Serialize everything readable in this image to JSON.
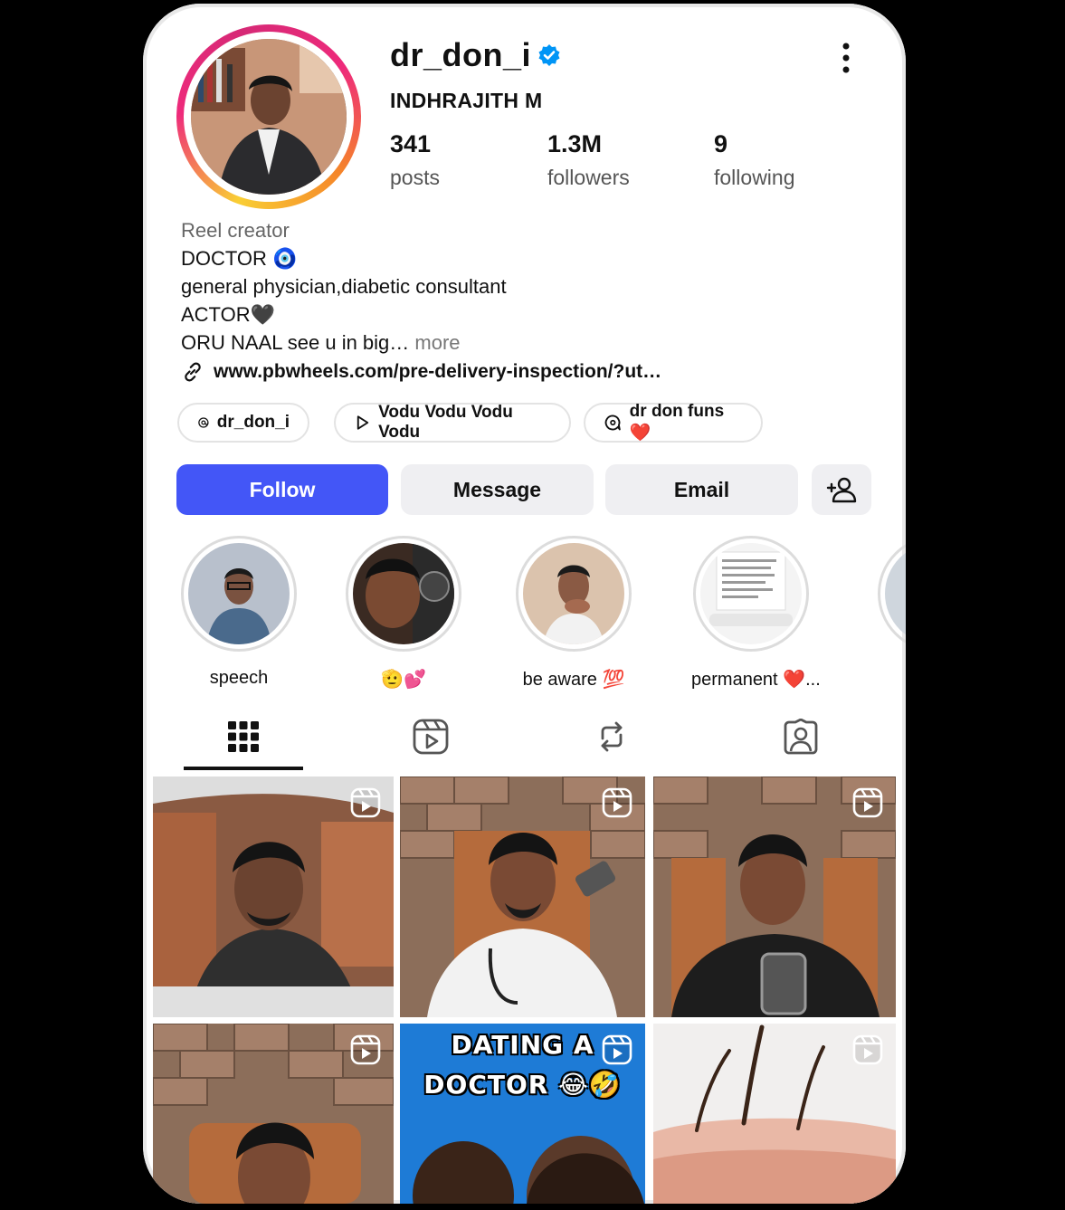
{
  "profile": {
    "username": "dr_don_i",
    "full_name": "INDHRAJITH M",
    "stats": [
      {
        "value": "341",
        "label": "posts"
      },
      {
        "value": "1.3M",
        "label": "followers"
      },
      {
        "value": "9",
        "label": "following"
      }
    ],
    "category": "Reel creator",
    "bio_lines": [
      "DOCTOR 🧿",
      "general physician,diabetic consultant",
      "ACTOR🖤",
      "ORU NAAL see u in big…"
    ],
    "bio_more": "more",
    "link": "www.pbwheels.com/pre-delivery-inspection/?ut…"
  },
  "chips": [
    {
      "icon": "threads-icon",
      "label": "dr_don_i"
    },
    {
      "icon": "play-icon",
      "label": "Vodu Vodu Vodu Vodu"
    },
    {
      "icon": "channel-icon",
      "label": "dr don funs ❤️"
    }
  ],
  "actions": {
    "follow": "Follow",
    "message": "Message",
    "email": "Email"
  },
  "highlights": [
    {
      "label": "speech"
    },
    {
      "label": "🫡💕"
    },
    {
      "label": "be aware 💯"
    },
    {
      "label": "permanent ❤️..."
    }
  ],
  "tabs": [
    "grid-icon",
    "reels-icon",
    "reposts-icon",
    "tagged-icon"
  ],
  "grid_posts": [
    {
      "caption": ""
    },
    {
      "caption": ""
    },
    {
      "caption": ""
    },
    {
      "caption": ""
    },
    {
      "caption": "DATING A\nDOCTOR 😂🤣"
    },
    {
      "caption": ""
    }
  ],
  "colors": {
    "follow_button": "#4356f7",
    "verified": "#0095f6",
    "ring_start": "#f9ce34",
    "ring_end": "#ee2a7b"
  }
}
